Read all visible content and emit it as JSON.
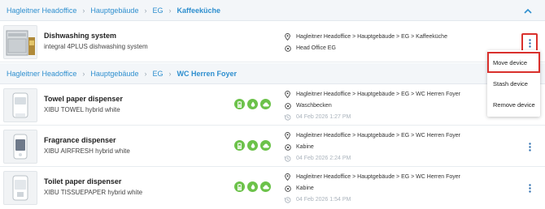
{
  "groups": [
    {
      "breadcrumb": [
        "Hagleitner Headoffice",
        "Hauptgebäude",
        "EG",
        "Kaffeeküche"
      ],
      "devices": [
        {
          "name": "Dishwashing system",
          "model": "integral 4PLUS dishwashing system",
          "location": "Hagleitner Headoffice > Hauptgebäude > EG > Kaffeeküche",
          "place": "Head Office EG",
          "date": ""
        }
      ]
    },
    {
      "breadcrumb": [
        "Hagleitner Headoffice",
        "Hauptgebäude",
        "EG",
        "WC Herren Foyer"
      ],
      "devices": [
        {
          "name": "Towel paper dispenser",
          "model": "XIBU TOWEL hybrid white",
          "location": "Hagleitner Headoffice > Hauptgebäude > EG > WC Herren Foyer",
          "place": "Waschbecken",
          "date": "04 Feb 2026 1:27 PM"
        },
        {
          "name": "Fragrance dispenser",
          "model": "XIBU AIRFRESH hybrid white",
          "location": "Hagleitner Headoffice > Hauptgebäude > EG > WC Herren Foyer",
          "place": "Kabine",
          "date": "04 Feb 2026 2:24 PM"
        },
        {
          "name": "Toilet paper dispenser",
          "model": "XIBU TISSUEPAPER hybrid white",
          "location": "Hagleitner Headoffice > Hauptgebäude > EG > WC Herren Foyer",
          "place": "Kabine",
          "date": "04 Feb 2026 1:54 PM"
        }
      ]
    }
  ],
  "context_menu": {
    "move": "Move device",
    "stash": "Stash device",
    "remove": "Remove device"
  },
  "colors": {
    "link": "#2e8fcf",
    "badge": "#6cc24a",
    "highlight": "#d9302c"
  },
  "icons": {
    "location": "map-pin-icon",
    "place": "target-icon",
    "date": "clock-history-icon",
    "collapse": "chevron-up-icon",
    "more": "kebab-menu-icon",
    "status": [
      "battery-icon",
      "drop-icon",
      "cloud-icon"
    ]
  }
}
